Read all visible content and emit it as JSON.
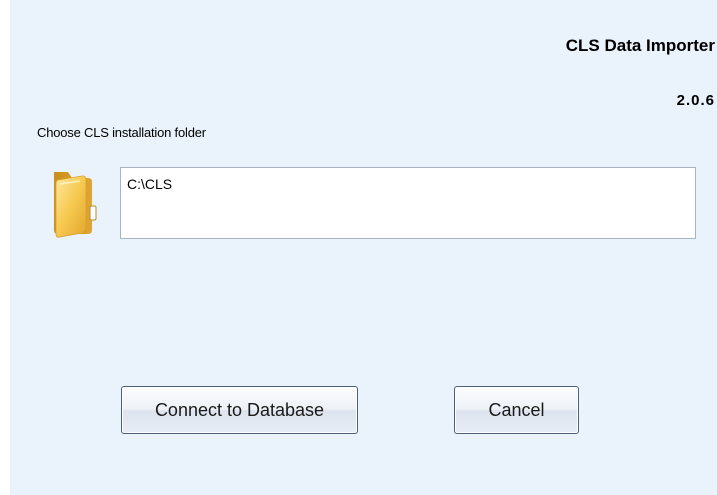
{
  "app": {
    "title": "CLS Data Importer",
    "version": "2.0.6"
  },
  "folder_picker": {
    "label": "Choose CLS installation folder",
    "icon": "folder-icon",
    "path_value": "C:\\CLS"
  },
  "buttons": {
    "connect_label": "Connect to Database",
    "cancel_label": "Cancel"
  },
  "colors": {
    "panel_background": "#eaf2fb",
    "folder_icon": "#f5c451"
  }
}
